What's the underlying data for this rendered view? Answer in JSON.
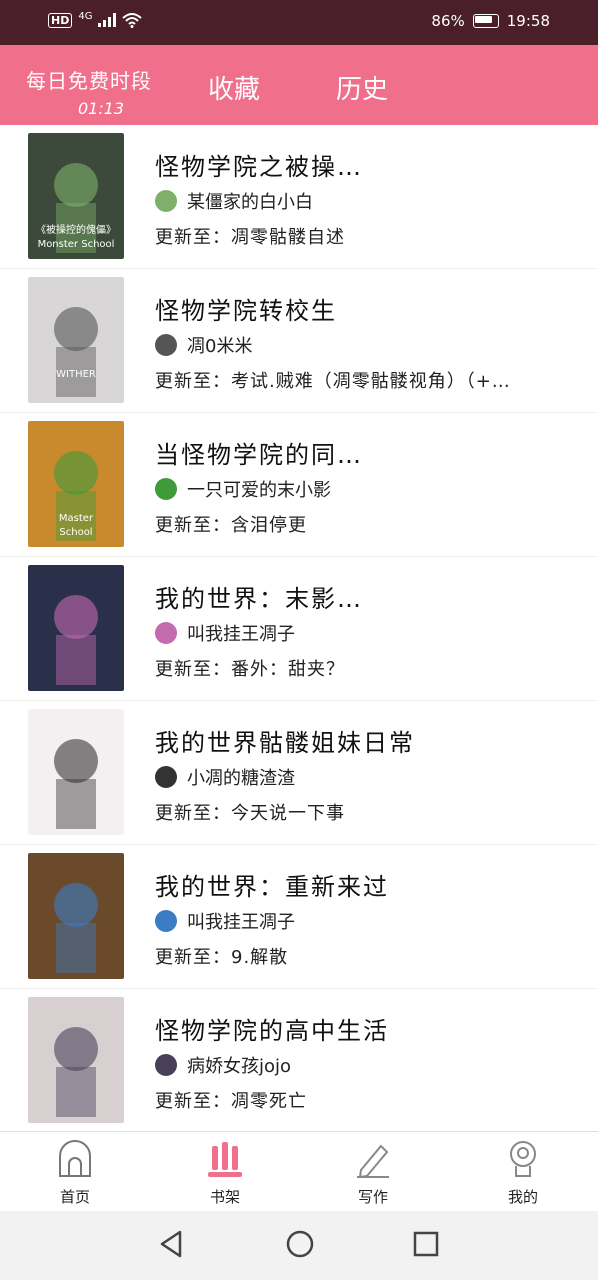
{
  "status_bar": {
    "network": "4G",
    "hd": "HD",
    "battery": "86%",
    "battery_level": 0.86,
    "time": "19:58"
  },
  "header": {
    "free_period_label": "每日免费时段",
    "free_period_time": "01:13",
    "tab_favorites": "收藏",
    "tab_history": "历史"
  },
  "books": [
    {
      "title": "怪物学院之被操…",
      "author": "某僵家的白小白",
      "update_prefix": "更新至：",
      "update": "凋零骷髅自述"
    },
    {
      "title": "怪物学院转校生",
      "author": "凋0米米",
      "update_prefix": "更新至：",
      "update": "考试.贼难（凋零骷髅视角）（+…"
    },
    {
      "title": "当怪物学院的同…",
      "author": "一只可爱的末小影",
      "update_prefix": "更新至：",
      "update": "含泪停更"
    },
    {
      "title": "我的世界：末影…",
      "author": "叫我挂王凋子",
      "update_prefix": "更新至：",
      "update": "番外：甜夹？"
    },
    {
      "title": "我的世界骷髅姐妹日常",
      "author": "小凋的糖渣渣",
      "update_prefix": "更新至：",
      "update": "今天说一下事"
    },
    {
      "title": "我的世界：重新来过",
      "author": "叫我挂王凋子",
      "update_prefix": "更新至：",
      "update": "9.解散"
    },
    {
      "title": "怪物学院的高中生活",
      "author": "病娇女孩jojo",
      "update_prefix": "更新至：",
      "update": "凋零死亡"
    }
  ],
  "covers": [
    {
      "text_lines": [
        "《被操控的傀儡》",
        "Monster School"
      ],
      "bg": "#3b4a3a",
      "accent": "#7fb069"
    },
    {
      "text_lines": [
        "WITHER"
      ],
      "bg": "#d9d6d8",
      "accent": "#555555"
    },
    {
      "text_lines": [
        "Master",
        "School"
      ],
      "bg": "#c98a2e",
      "accent": "#3f9b3a"
    },
    {
      "text_lines": [],
      "bg": "#2a2f4a",
      "accent": "#c46bb0"
    },
    {
      "text_lines": [],
      "bg": "#f4f0f2",
      "accent": "#333333"
    },
    {
      "text_lines": [],
      "bg": "#6a4a2a",
      "accent": "#3b7dc4"
    },
    {
      "text_lines": [],
      "bg": "#d8d0d0",
      "accent": "#4a3f5a"
    }
  ],
  "bottom_nav": [
    {
      "label": "首页",
      "icon": "home-icon"
    },
    {
      "label": "书架",
      "icon": "bookshelf-icon"
    },
    {
      "label": "写作",
      "icon": "pencil-icon"
    },
    {
      "label": "我的",
      "icon": "profile-icon"
    }
  ],
  "colors": {
    "accent": "#f06f8b",
    "status_bar": "#4a1f2a",
    "active_icon": "#f06f8b"
  }
}
